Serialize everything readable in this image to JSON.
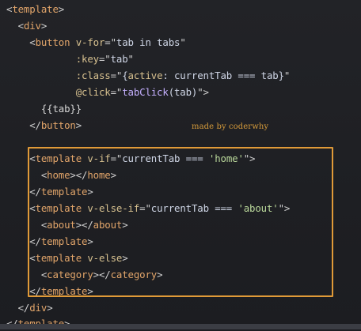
{
  "editor": {
    "lines": [
      {
        "id": "l1",
        "indent": "",
        "parts": [
          {
            "c": "punct",
            "t": "<"
          },
          {
            "c": "tag",
            "t": "template"
          },
          {
            "c": "punct",
            "t": ">"
          }
        ]
      },
      {
        "id": "l2",
        "indent": "  ",
        "parts": [
          {
            "c": "punct",
            "t": "<"
          },
          {
            "c": "tag",
            "t": "div"
          },
          {
            "c": "punct",
            "t": ">"
          }
        ]
      },
      {
        "id": "l3",
        "indent": "    ",
        "parts": [
          {
            "c": "punct",
            "t": "<"
          },
          {
            "c": "tag",
            "t": "button"
          },
          {
            "c": "plain",
            "t": " "
          },
          {
            "c": "attr",
            "t": "v-for"
          },
          {
            "c": "punct",
            "t": "=\""
          },
          {
            "c": "expr",
            "t": "tab in tabs"
          },
          {
            "c": "punct",
            "t": "\""
          }
        ]
      },
      {
        "id": "l4",
        "indent": "            ",
        "parts": [
          {
            "c": "attr",
            "t": ":key"
          },
          {
            "c": "punct",
            "t": "=\""
          },
          {
            "c": "expr",
            "t": "tab"
          },
          {
            "c": "punct",
            "t": "\""
          }
        ]
      },
      {
        "id": "l5",
        "indent": "            ",
        "parts": [
          {
            "c": "attr",
            "t": ":class"
          },
          {
            "c": "punct",
            "t": "=\""
          },
          {
            "c": "expr",
            "t": "{"
          },
          {
            "c": "attr",
            "t": "active"
          },
          {
            "c": "expr",
            "t": ": currentTab === tab}"
          },
          {
            "c": "punct",
            "t": "\""
          }
        ]
      },
      {
        "id": "l6",
        "indent": "            ",
        "parts": [
          {
            "c": "attr",
            "t": "@click"
          },
          {
            "c": "punct",
            "t": "=\""
          },
          {
            "c": "fn",
            "t": "tabClick"
          },
          {
            "c": "expr",
            "t": "(tab)"
          },
          {
            "c": "punct",
            "t": "\">"
          }
        ]
      },
      {
        "id": "l7",
        "indent": "      ",
        "parts": [
          {
            "c": "plain",
            "t": "{{tab}}"
          }
        ]
      },
      {
        "id": "l8",
        "indent": "    ",
        "parts": [
          {
            "c": "punct",
            "t": "</"
          },
          {
            "c": "tag",
            "t": "button"
          },
          {
            "c": "punct",
            "t": ">"
          }
        ]
      },
      {
        "id": "l9",
        "indent": "",
        "parts": []
      },
      {
        "id": "l10",
        "indent": "    ",
        "parts": [
          {
            "c": "punct",
            "t": "<"
          },
          {
            "c": "tag",
            "t": "template"
          },
          {
            "c": "plain",
            "t": " "
          },
          {
            "c": "attr",
            "t": "v-if"
          },
          {
            "c": "punct",
            "t": "=\""
          },
          {
            "c": "expr",
            "t": "currentTab === "
          },
          {
            "c": "str",
            "t": "'home'"
          },
          {
            "c": "punct",
            "t": "\">"
          }
        ]
      },
      {
        "id": "l11",
        "indent": "      ",
        "parts": [
          {
            "c": "punct",
            "t": "<"
          },
          {
            "c": "tag",
            "t": "home"
          },
          {
            "c": "punct",
            "t": "></"
          },
          {
            "c": "tag",
            "t": "home"
          },
          {
            "c": "punct",
            "t": ">"
          }
        ]
      },
      {
        "id": "l12",
        "indent": "    ",
        "parts": [
          {
            "c": "punct",
            "t": "</"
          },
          {
            "c": "tag",
            "t": "template"
          },
          {
            "c": "punct",
            "t": ">"
          }
        ]
      },
      {
        "id": "l13",
        "indent": "    ",
        "parts": [
          {
            "c": "punct",
            "t": "<"
          },
          {
            "c": "tag",
            "t": "template"
          },
          {
            "c": "plain",
            "t": " "
          },
          {
            "c": "attr",
            "t": "v-else-if"
          },
          {
            "c": "punct",
            "t": "=\""
          },
          {
            "c": "expr",
            "t": "currentTab === "
          },
          {
            "c": "str",
            "t": "'about'"
          },
          {
            "c": "punct",
            "t": "\">"
          }
        ]
      },
      {
        "id": "l14",
        "indent": "      ",
        "parts": [
          {
            "c": "punct",
            "t": "<"
          },
          {
            "c": "tag",
            "t": "about"
          },
          {
            "c": "punct",
            "t": "></"
          },
          {
            "c": "tag",
            "t": "about"
          },
          {
            "c": "punct",
            "t": ">"
          }
        ]
      },
      {
        "id": "l15",
        "indent": "    ",
        "parts": [
          {
            "c": "punct",
            "t": "</"
          },
          {
            "c": "tag",
            "t": "template"
          },
          {
            "c": "punct",
            "t": ">"
          }
        ]
      },
      {
        "id": "l16",
        "indent": "    ",
        "parts": [
          {
            "c": "punct",
            "t": "<"
          },
          {
            "c": "tag",
            "t": "template"
          },
          {
            "c": "plain",
            "t": " "
          },
          {
            "c": "attr",
            "t": "v-else"
          },
          {
            "c": "punct",
            "t": ">"
          }
        ]
      },
      {
        "id": "l17",
        "indent": "      ",
        "parts": [
          {
            "c": "punct",
            "t": "<"
          },
          {
            "c": "tag",
            "t": "category"
          },
          {
            "c": "punct",
            "t": "></"
          },
          {
            "c": "tag",
            "t": "category"
          },
          {
            "c": "punct",
            "t": ">"
          }
        ]
      },
      {
        "id": "l18",
        "indent": "    ",
        "parts": [
          {
            "c": "punct",
            "t": "</"
          },
          {
            "c": "tag",
            "t": "template"
          },
          {
            "c": "punct",
            "t": ">"
          }
        ]
      },
      {
        "id": "l19",
        "indent": "  ",
        "parts": [
          {
            "c": "punct",
            "t": "</"
          },
          {
            "c": "tag",
            "t": "div"
          },
          {
            "c": "punct",
            "t": ">"
          }
        ]
      },
      {
        "id": "l20",
        "indent": "",
        "parts": [
          {
            "c": "punct",
            "t": "</"
          },
          {
            "c": "tag",
            "t": "template"
          },
          {
            "c": "punct",
            "t": ">"
          }
        ]
      }
    ]
  },
  "watermark": {
    "text": "made by coderwhy"
  },
  "colors": {
    "background": "#1d1e22",
    "tag": "#e2a56a",
    "attribute": "#d6c08f",
    "string": "#b9d79a",
    "function": "#c5b0ff",
    "highlight_border": "#e09a38",
    "watermark": "#d59a3a"
  }
}
